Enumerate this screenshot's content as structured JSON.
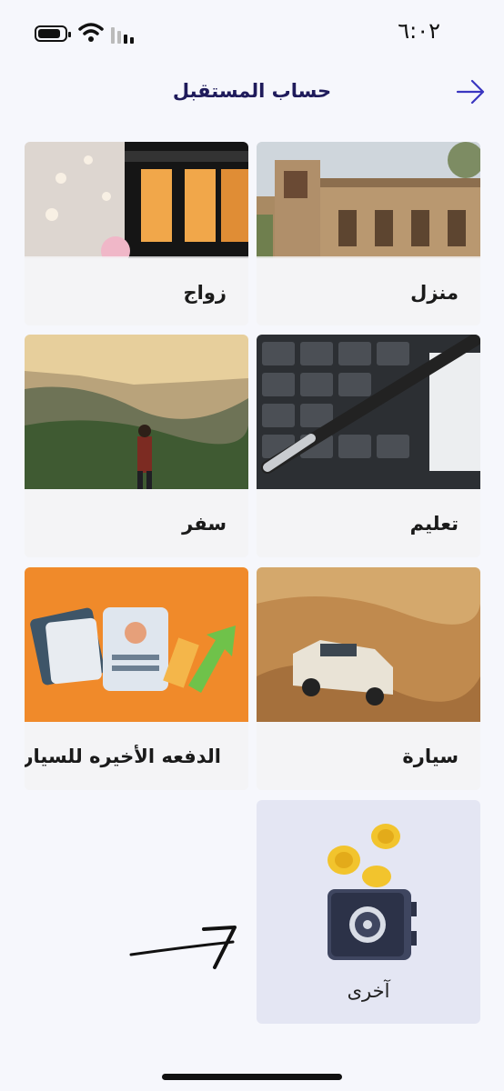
{
  "status_bar": {
    "time": "٦:٠٢"
  },
  "header": {
    "title": "حساب المستقبل"
  },
  "categories": [
    {
      "label": "منزل"
    },
    {
      "label": "زواج"
    },
    {
      "label": "تعليم"
    },
    {
      "label": "سفر"
    },
    {
      "label": "سيارة"
    },
    {
      "label": "الدفعه الأخيره للسياره"
    },
    {
      "label": "آخرى"
    }
  ],
  "colors": {
    "title": "#1f1b5b",
    "accent": "#3a36c0",
    "other_card_bg": "#e4e6f3"
  }
}
